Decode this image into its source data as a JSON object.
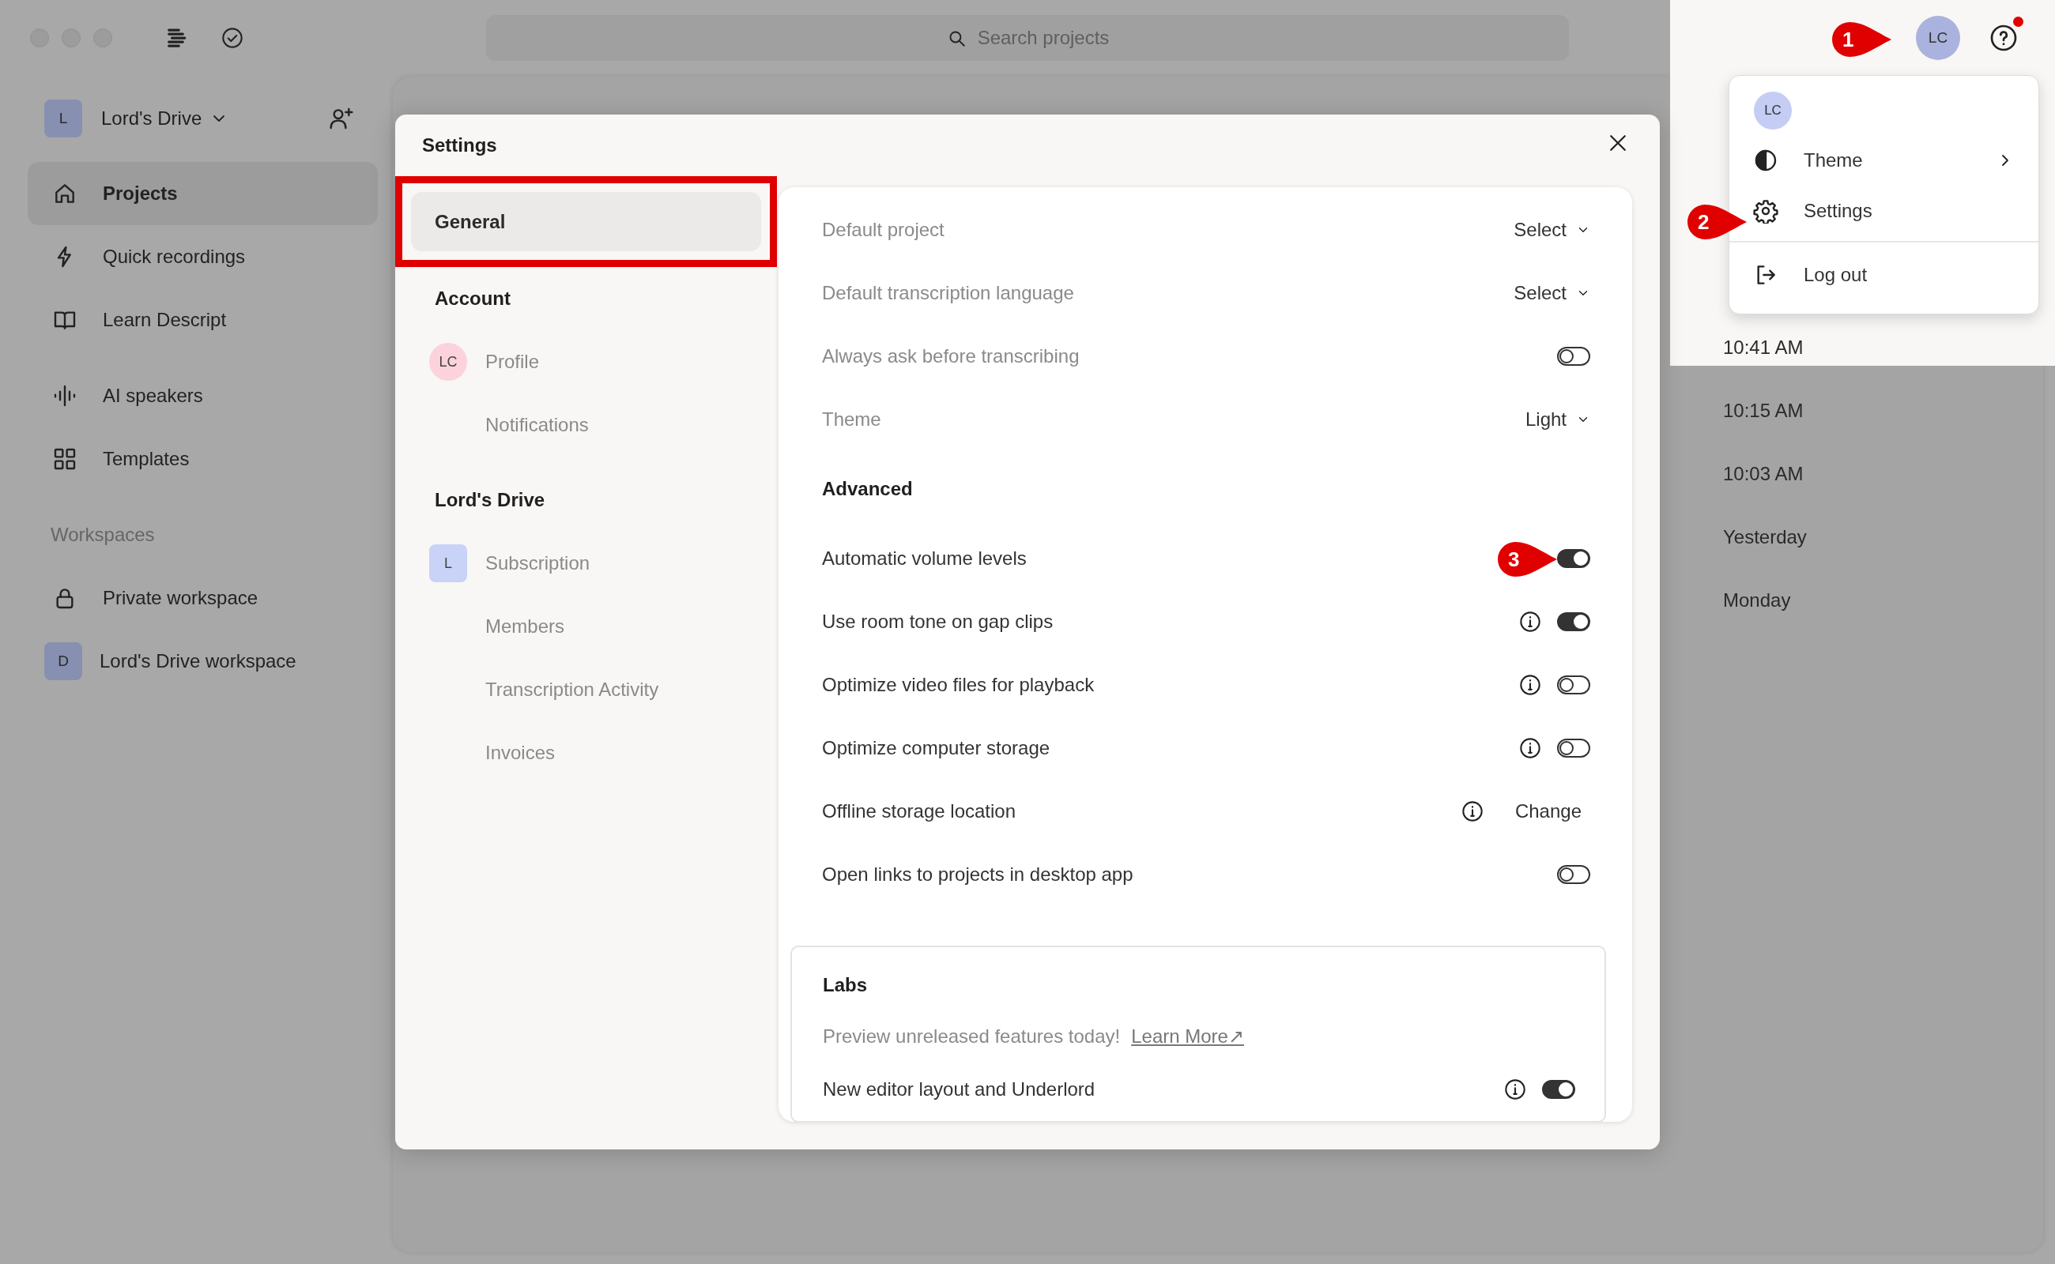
{
  "titlebar": {
    "search": {
      "placeholder": "Search projects"
    },
    "account_avatar": "LC",
    "notification": true
  },
  "sidebar": {
    "drive": {
      "avatar": "L",
      "name": "Lord's Drive"
    },
    "items": [
      {
        "label": "Projects",
        "selected": true
      },
      {
        "label": "Quick recordings",
        "selected": false
      },
      {
        "label": "Learn Descript",
        "selected": false
      },
      {
        "label": "AI speakers",
        "selected": false
      },
      {
        "label": "Templates",
        "selected": false
      }
    ],
    "workspaces": {
      "heading": "Workspaces",
      "items": [
        {
          "label": "Private workspace",
          "kind": "lock"
        },
        {
          "label": "Lord's Drive workspace",
          "kind": "avatar",
          "avatar": "D"
        }
      ]
    }
  },
  "project_times": [
    "10:41 AM",
    "10:15 AM",
    "10:03 AM",
    "Yesterday",
    "Monday"
  ],
  "account_menu": {
    "avatar": "LC",
    "items": [
      {
        "label": "Theme",
        "submenu": true,
        "divider_before": false
      },
      {
        "label": "Settings",
        "submenu": false,
        "divider_before": false
      },
      {
        "label": "Log out",
        "submenu": false,
        "divider_before": true
      }
    ]
  },
  "settings": {
    "title": "Settings",
    "nav": [
      {
        "label": "General",
        "kind": "item",
        "selected": true,
        "highlighted": true
      },
      {
        "label": "Account",
        "kind": "heading"
      },
      {
        "label": "Profile",
        "kind": "item",
        "selected": false,
        "highlighted": false,
        "avatar": "LC",
        "color": "#fcd3dd"
      },
      {
        "label": "Notifications",
        "kind": "item",
        "selected": false,
        "highlighted": false
      },
      {
        "label": "Lord's Drive",
        "kind": "heading"
      },
      {
        "label": "Subscription",
        "kind": "item",
        "selected": false,
        "highlighted": false,
        "avatar": "L",
        "color": "#c9d3f7"
      },
      {
        "label": "Members",
        "kind": "item",
        "selected": false,
        "highlighted": false
      },
      {
        "label": "Transcription Activity",
        "kind": "item",
        "selected": false,
        "highlighted": false
      },
      {
        "label": "Invoices",
        "kind": "item",
        "selected": false,
        "highlighted": false
      }
    ],
    "sections": [
      {
        "dimmed": true,
        "rows": [
          {
            "label": "Default project",
            "kind": "select",
            "value": "Select",
            "info": false
          },
          {
            "label": "Default transcription language",
            "kind": "select",
            "value": "Select",
            "info": false
          },
          {
            "label": "Always ask before transcribing",
            "kind": "toggle",
            "on": false,
            "info": false
          },
          {
            "label": "Theme",
            "kind": "select",
            "value": "Light",
            "info": false
          }
        ]
      },
      {
        "heading": "Advanced",
        "dimmed": false,
        "rows": [
          {
            "label": "Automatic volume levels",
            "kind": "toggle",
            "on": true,
            "info": false
          },
          {
            "label": "Use room tone on gap clips",
            "kind": "toggle",
            "on": true,
            "info": true
          },
          {
            "label": "Optimize video files for playback",
            "kind": "toggle",
            "on": false,
            "info": true
          },
          {
            "label": "Optimize computer storage",
            "kind": "toggle",
            "on": false,
            "info": true
          },
          {
            "label": "Offline storage location",
            "kind": "button",
            "value": "Change",
            "info": true
          },
          {
            "label": "Open links to projects in desktop app",
            "kind": "toggle",
            "on": false,
            "info": false
          }
        ]
      }
    ],
    "labs": {
      "heading": "Labs",
      "description": "Preview unreleased features today!",
      "link": "Learn More↗",
      "rows": [
        {
          "label": "New editor layout and Underlord",
          "kind": "toggle",
          "on": true,
          "info": true
        }
      ]
    }
  },
  "annotations": [
    "1",
    "2",
    "3"
  ]
}
